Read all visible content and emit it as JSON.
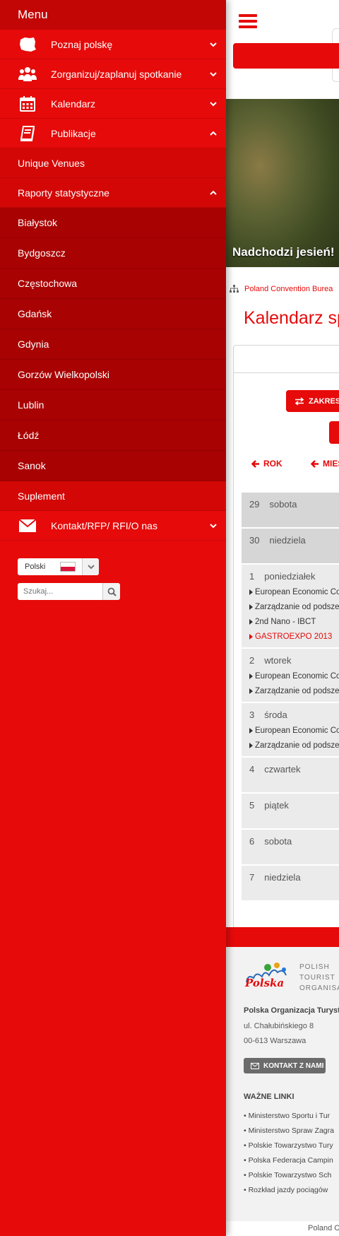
{
  "sidebar": {
    "title": "Menu",
    "items": [
      {
        "label": "Poznaj polskę",
        "icon": "poland-map-icon",
        "expanded": false
      },
      {
        "label": "Zorganizuj/zaplanuj spotkanie",
        "icon": "people-icon",
        "expanded": false
      },
      {
        "label": "Kalendarz",
        "icon": "calendar-icon",
        "expanded": false
      },
      {
        "label": "Publikacje",
        "icon": "book-icon",
        "expanded": true
      },
      {
        "label": "Kontakt/RFP/ RFI/O nas",
        "icon": "envelope-icon",
        "expanded": false
      }
    ],
    "publikacje_sub": [
      {
        "label": "Unique Venues"
      },
      {
        "label": "Raporty statystyczne",
        "expanded": true
      }
    ],
    "cities": [
      "Białystok",
      "Bydgoszcz",
      "Częstochowa",
      "Gdańsk",
      "Gdynia",
      "Gorzów Wielkopolski",
      "Lublin",
      "Łódź",
      "Sanok"
    ],
    "suplement": "Suplement",
    "language": "Polski",
    "search_placeholder": "Szukaj..."
  },
  "main": {
    "hero_caption": "Nadchodzi jesień!",
    "breadcrumb": "Poland Convention Burea",
    "page_title": "Kalendarz spo",
    "range_button": "ZAKRES",
    "nav": {
      "year": "ROK",
      "month": "MIES"
    },
    "days": [
      {
        "num": "29",
        "name": "sobota",
        "events": []
      },
      {
        "num": "30",
        "name": "niedziela",
        "events": []
      },
      {
        "num": "1",
        "name": "poniedziałek",
        "events": [
          {
            "title": "European Economic Congr",
            "highlight": false
          },
          {
            "title": "Zarządzanie od podszewki",
            "highlight": false
          },
          {
            "title": "2nd Nano - IBCT",
            "highlight": false
          },
          {
            "title": "GASTROEXPO 2013",
            "highlight": true
          }
        ]
      },
      {
        "num": "2",
        "name": "wtorek",
        "events": [
          {
            "title": "European Economic Congr",
            "highlight": false
          },
          {
            "title": "Zarządzanie od podszewki",
            "highlight": false
          }
        ]
      },
      {
        "num": "3",
        "name": "środa",
        "events": [
          {
            "title": "European Economic Congr",
            "highlight": false
          },
          {
            "title": "Zarządzanie od podszewki",
            "highlight": false
          }
        ]
      },
      {
        "num": "4",
        "name": "czwartek",
        "events": []
      },
      {
        "num": "5",
        "name": "piątek",
        "events": []
      },
      {
        "num": "6",
        "name": "sobota",
        "events": []
      },
      {
        "num": "7",
        "name": "niedziela",
        "events": []
      }
    ]
  },
  "footer": {
    "logo_text": "Polska",
    "org_lines": [
      "POLISH",
      "TOURIST",
      "ORGANISAT"
    ],
    "org_name": "Polska Organizacja Turysty",
    "address1": "ul. Chałubińskiego 8",
    "address2": "00-613 Warszawa",
    "contact_button": "KONTAKT Z NAMI",
    "links_title": "WAŻNE LINKI",
    "links": [
      "• Ministerstwo Sportu i Tur",
      "• Ministerstwo Spraw Zagra",
      "• Polskie Towarzystwo Tury",
      "• Polska Federacja Campin",
      "• Polskie Towarzystwo Sch",
      "• Rozkład jazdy pociągów"
    ],
    "copyright": "Poland C"
  },
  "colors": {
    "brand_red": "#e60a0a",
    "dark_red": "#a90202"
  }
}
